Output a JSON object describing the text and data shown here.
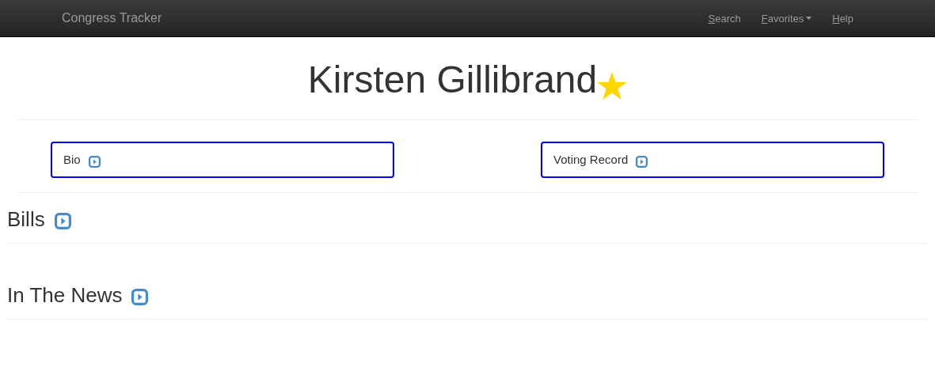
{
  "navbar": {
    "brand": "Congress Tracker",
    "links": [
      {
        "label": "Search",
        "underline_first": true,
        "dropdown": false
      },
      {
        "label": "Favorites",
        "underline_first": true,
        "dropdown": true
      },
      {
        "label": "Help",
        "underline_first": true,
        "dropdown": false
      }
    ]
  },
  "person": {
    "name": "Kirsten Gillibrand",
    "favorite": true
  },
  "panels": [
    {
      "label": "Bio"
    },
    {
      "label": "Voting Record"
    }
  ],
  "sections": [
    {
      "title": "Bills"
    },
    {
      "title": "In The News"
    }
  ]
}
